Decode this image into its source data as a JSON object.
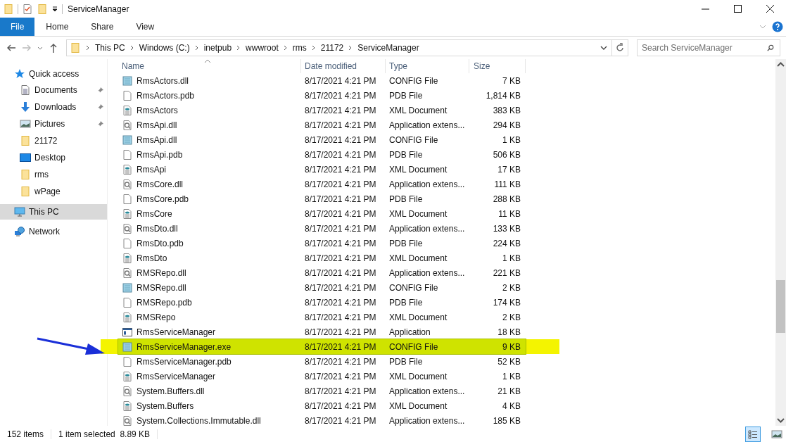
{
  "window": {
    "title": "ServiceManager"
  },
  "ribbon_tabs": [
    {
      "label": "File",
      "selected": true
    },
    {
      "label": "Home",
      "selected": false
    },
    {
      "label": "Share",
      "selected": false
    },
    {
      "label": "View",
      "selected": false
    }
  ],
  "breadcrumb": [
    "This PC",
    "Windows (C:)",
    "inetpub",
    "wwwroot",
    "rms",
    "21172",
    "ServiceManager"
  ],
  "search": {
    "placeholder": "Search ServiceManager"
  },
  "sidebar": [
    {
      "label": "Quick access",
      "kind": "star",
      "selected": false,
      "children": [
        {
          "label": "Documents",
          "kind": "documents",
          "pinned": true,
          "selected": false
        },
        {
          "label": "Downloads",
          "kind": "downloads",
          "pinned": true,
          "selected": false
        },
        {
          "label": "Pictures",
          "kind": "pictures",
          "pinned": true,
          "selected": false
        },
        {
          "label": "21172",
          "kind": "folder",
          "pinned": false,
          "selected": false
        },
        {
          "label": "Desktop",
          "kind": "desktop",
          "pinned": false,
          "selected": false
        },
        {
          "label": "rms",
          "kind": "folder",
          "pinned": false,
          "selected": false
        },
        {
          "label": "wPage",
          "kind": "folder",
          "pinned": false,
          "selected": false
        }
      ]
    },
    {
      "label": "This PC",
      "kind": "pc",
      "selected": true
    },
    {
      "label": "Network",
      "kind": "network",
      "selected": false
    }
  ],
  "columns": [
    "Name",
    "Date modified",
    "Type",
    "Size"
  ],
  "rows": [
    {
      "name": "RmsActors.dll",
      "date": "8/17/2021 4:21 PM",
      "type": "CONFIG File",
      "size": "7 KB",
      "kind": "config",
      "selected": false
    },
    {
      "name": "RmsActors.pdb",
      "date": "8/17/2021 4:21 PM",
      "type": "PDB File",
      "size": "1,814 KB",
      "kind": "pdb",
      "selected": false
    },
    {
      "name": "RmsActors",
      "date": "8/17/2021 4:21 PM",
      "type": "XML Document",
      "size": "383 KB",
      "kind": "xml",
      "selected": false
    },
    {
      "name": "RmsApi.dll",
      "date": "8/17/2021 4:21 PM",
      "type": "Application extens...",
      "size": "294 KB",
      "kind": "dll",
      "selected": false
    },
    {
      "name": "RmsApi.dll",
      "date": "8/17/2021 4:21 PM",
      "type": "CONFIG File",
      "size": "1 KB",
      "kind": "config",
      "selected": false
    },
    {
      "name": "RmsApi.pdb",
      "date": "8/17/2021 4:21 PM",
      "type": "PDB File",
      "size": "506 KB",
      "kind": "pdb",
      "selected": false
    },
    {
      "name": "RmsApi",
      "date": "8/17/2021 4:21 PM",
      "type": "XML Document",
      "size": "17 KB",
      "kind": "xml",
      "selected": false
    },
    {
      "name": "RmsCore.dll",
      "date": "8/17/2021 4:21 PM",
      "type": "Application extens...",
      "size": "111 KB",
      "kind": "dll",
      "selected": false
    },
    {
      "name": "RmsCore.pdb",
      "date": "8/17/2021 4:21 PM",
      "type": "PDB File",
      "size": "288 KB",
      "kind": "pdb",
      "selected": false
    },
    {
      "name": "RmsCore",
      "date": "8/17/2021 4:21 PM",
      "type": "XML Document",
      "size": "11 KB",
      "kind": "xml",
      "selected": false
    },
    {
      "name": "RmsDto.dll",
      "date": "8/17/2021 4:21 PM",
      "type": "Application extens...",
      "size": "133 KB",
      "kind": "dll",
      "selected": false
    },
    {
      "name": "RmsDto.pdb",
      "date": "8/17/2021 4:21 PM",
      "type": "PDB File",
      "size": "224 KB",
      "kind": "pdb",
      "selected": false
    },
    {
      "name": "RmsDto",
      "date": "8/17/2021 4:21 PM",
      "type": "XML Document",
      "size": "1 KB",
      "kind": "xml",
      "selected": false
    },
    {
      "name": "RMSRepo.dll",
      "date": "8/17/2021 4:21 PM",
      "type": "Application extens...",
      "size": "221 KB",
      "kind": "dll",
      "selected": false
    },
    {
      "name": "RMSRepo.dll",
      "date": "8/17/2021 4:21 PM",
      "type": "CONFIG File",
      "size": "2 KB",
      "kind": "config",
      "selected": false
    },
    {
      "name": "RMSRepo.pdb",
      "date": "8/17/2021 4:21 PM",
      "type": "PDB File",
      "size": "174 KB",
      "kind": "pdb",
      "selected": false
    },
    {
      "name": "RMSRepo",
      "date": "8/17/2021 4:21 PM",
      "type": "XML Document",
      "size": "2 KB",
      "kind": "xml",
      "selected": false
    },
    {
      "name": "RmsServiceManager",
      "date": "8/17/2021 4:21 PM",
      "type": "Application",
      "size": "18 KB",
      "kind": "app",
      "selected": false
    },
    {
      "name": "RmsServiceManager.exe",
      "date": "8/17/2021 4:21 PM",
      "type": "CONFIG File",
      "size": "9 KB",
      "kind": "config",
      "selected": true
    },
    {
      "name": "RmsServiceManager.pdb",
      "date": "8/17/2021 4:21 PM",
      "type": "PDB File",
      "size": "52 KB",
      "kind": "pdb",
      "selected": false
    },
    {
      "name": "RmsServiceManager",
      "date": "8/17/2021 4:21 PM",
      "type": "XML Document",
      "size": "1 KB",
      "kind": "xml",
      "selected": false
    },
    {
      "name": "System.Buffers.dll",
      "date": "8/17/2021 4:21 PM",
      "type": "Application extens...",
      "size": "21 KB",
      "kind": "dll",
      "selected": false
    },
    {
      "name": "System.Buffers",
      "date": "8/17/2021 4:21 PM",
      "type": "XML Document",
      "size": "4 KB",
      "kind": "xml",
      "selected": false
    },
    {
      "name": "System.Collections.Immutable.dll",
      "date": "8/17/2021 4:21 PM",
      "type": "Application extens...",
      "size": "185 KB",
      "kind": "dll",
      "selected": false
    }
  ],
  "status_bar": {
    "item_count": "152 items",
    "selection": "1 item selected  8.89 KB"
  },
  "view_buttons": [
    {
      "kind": "details",
      "selected": true
    },
    {
      "kind": "tiles",
      "selected": false
    }
  ]
}
